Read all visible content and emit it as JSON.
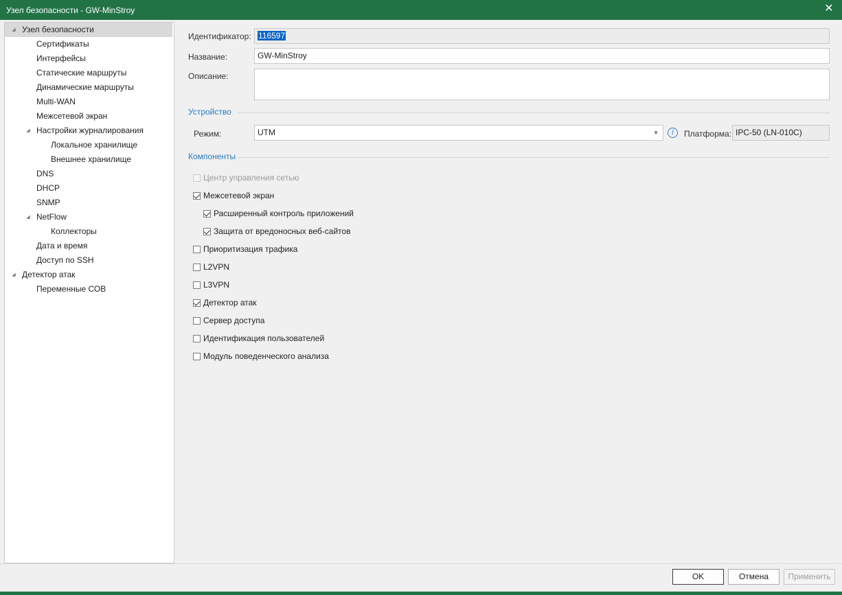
{
  "window": {
    "title": "Узел безопасности - GW-MinStroy",
    "close_glyph": "✕"
  },
  "tree": {
    "items": [
      {
        "label": "Узел безопасности",
        "expander": "◢",
        "selected": true
      },
      {
        "label": "Сертификаты"
      },
      {
        "label": "Интерфейсы"
      },
      {
        "label": "Статические маршруты"
      },
      {
        "label": "Динамические маршруты"
      },
      {
        "label": "Multi-WAN"
      },
      {
        "label": "Межсетевой экран"
      },
      {
        "label": "Настройки журналирования",
        "expander": "◢"
      },
      {
        "label": "Локальное хранилище"
      },
      {
        "label": "Внешнее хранилище"
      },
      {
        "label": "DNS"
      },
      {
        "label": "DHCP"
      },
      {
        "label": "SNMP"
      },
      {
        "label": "NetFlow",
        "expander": "◢"
      },
      {
        "label": "Коллекторы"
      },
      {
        "label": "Дата и время"
      },
      {
        "label": "Доступ по SSH"
      },
      {
        "label": "Детектор атак",
        "expander": "◢"
      },
      {
        "label": "Переменные СОВ"
      }
    ]
  },
  "form": {
    "id_label": "Идентификатор:",
    "id_value": "116597",
    "name_label": "Название:",
    "name_value": "GW-MinStroy",
    "desc_label": "Описание:",
    "desc_value": ""
  },
  "device": {
    "section_title": "Устройство",
    "mode_label": "Режим:",
    "mode_value": "UTM",
    "info_glyph": "i",
    "platform_label": "Платформа:",
    "platform_value": "IPC-50 (LN-010C)"
  },
  "components": {
    "section_title": "Компоненты",
    "items": [
      {
        "label": "Центр управления сетью",
        "checked": false,
        "disabled": true
      },
      {
        "label": "Межсетевой экран",
        "checked": true
      },
      {
        "label": "Расширенный контроль приложений",
        "checked": true
      },
      {
        "label": "Защита от вредоносных веб-сайтов",
        "checked": true
      },
      {
        "label": "Приоритизация трафика",
        "checked": false
      },
      {
        "label": "L2VPN",
        "checked": false
      },
      {
        "label": "L3VPN",
        "checked": false
      },
      {
        "label": "Детектор атак",
        "checked": true
      },
      {
        "label": "Сервер доступа",
        "checked": false
      },
      {
        "label": "Идентификация пользователей",
        "checked": false
      },
      {
        "label": "Модуль поведенческого анализа",
        "checked": false
      }
    ]
  },
  "buttons": {
    "ok": "OK",
    "cancel": "Отмена",
    "apply": "Применить"
  },
  "colors": {
    "titlebar": "#217346",
    "section": "#2a7bc1",
    "selection": "#0a64c8"
  }
}
